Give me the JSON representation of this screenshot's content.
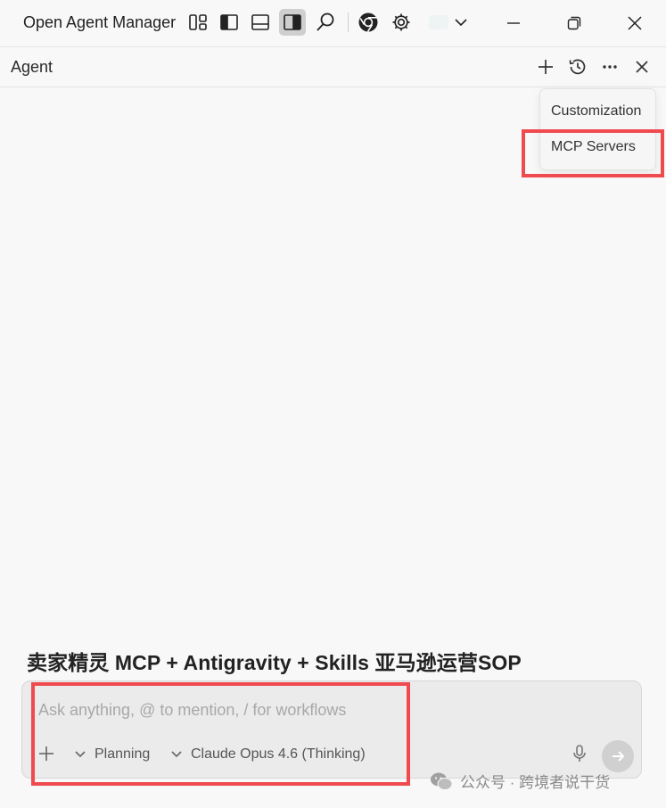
{
  "titlebar": {
    "app_name": "Open Agent Manager",
    "icons": [
      "layout-icon",
      "sidebar-left-icon",
      "panel-bottom-icon",
      "sidebar-right-icon",
      "search-icon",
      "chrome-icon",
      "gear-icon",
      "chevron-down-icon"
    ],
    "window_controls": [
      "minimize-icon",
      "restore-icon",
      "close-icon"
    ]
  },
  "agent_panel": {
    "title": "Agent",
    "actions": [
      "plus-icon",
      "history-icon",
      "more-icon",
      "close-icon"
    ]
  },
  "dropdown_menu": {
    "items": [
      {
        "label": "Customization"
      },
      {
        "label": "MCP Servers"
      }
    ]
  },
  "prompt_heading": "卖家精灵 MCP + Antigravity + Skills 亚马逊运营SOP",
  "chat_input": {
    "placeholder": "Ask anything, @ to mention, / for workflows",
    "mode_label": "Planning",
    "model_label": "Claude Opus 4.6 (Thinking)"
  },
  "watermark": {
    "text": "公众号 · 跨境者说干货"
  },
  "colors": {
    "highlight": "#ef4b4f",
    "background": "#f8f8f8",
    "input_bg": "#ebebeb"
  }
}
